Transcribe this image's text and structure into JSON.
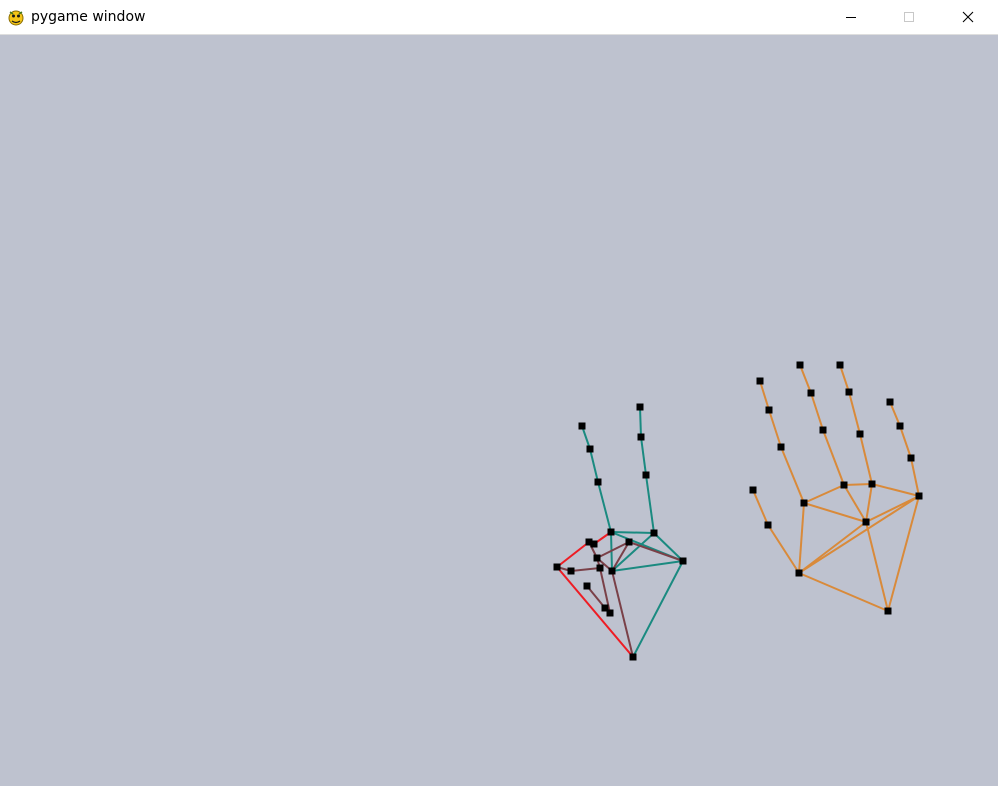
{
  "window": {
    "title": "pygame window",
    "icon": "pygame-snake-icon",
    "buttons": [
      "minimize-icon",
      "maximize-icon",
      "close-icon"
    ]
  },
  "scene": {
    "background_color": "#bec2cf",
    "point_color": "#000000",
    "hands": [
      {
        "name": "",
        "colors": {
          "skeleton": "#1a8a80",
          "palm": "#7a4048",
          "thumb": "#ee1c24"
        }
      },
      {
        "name": "",
        "colors": {
          "skeleton": "#d98a3a"
        }
      }
    ]
  }
}
